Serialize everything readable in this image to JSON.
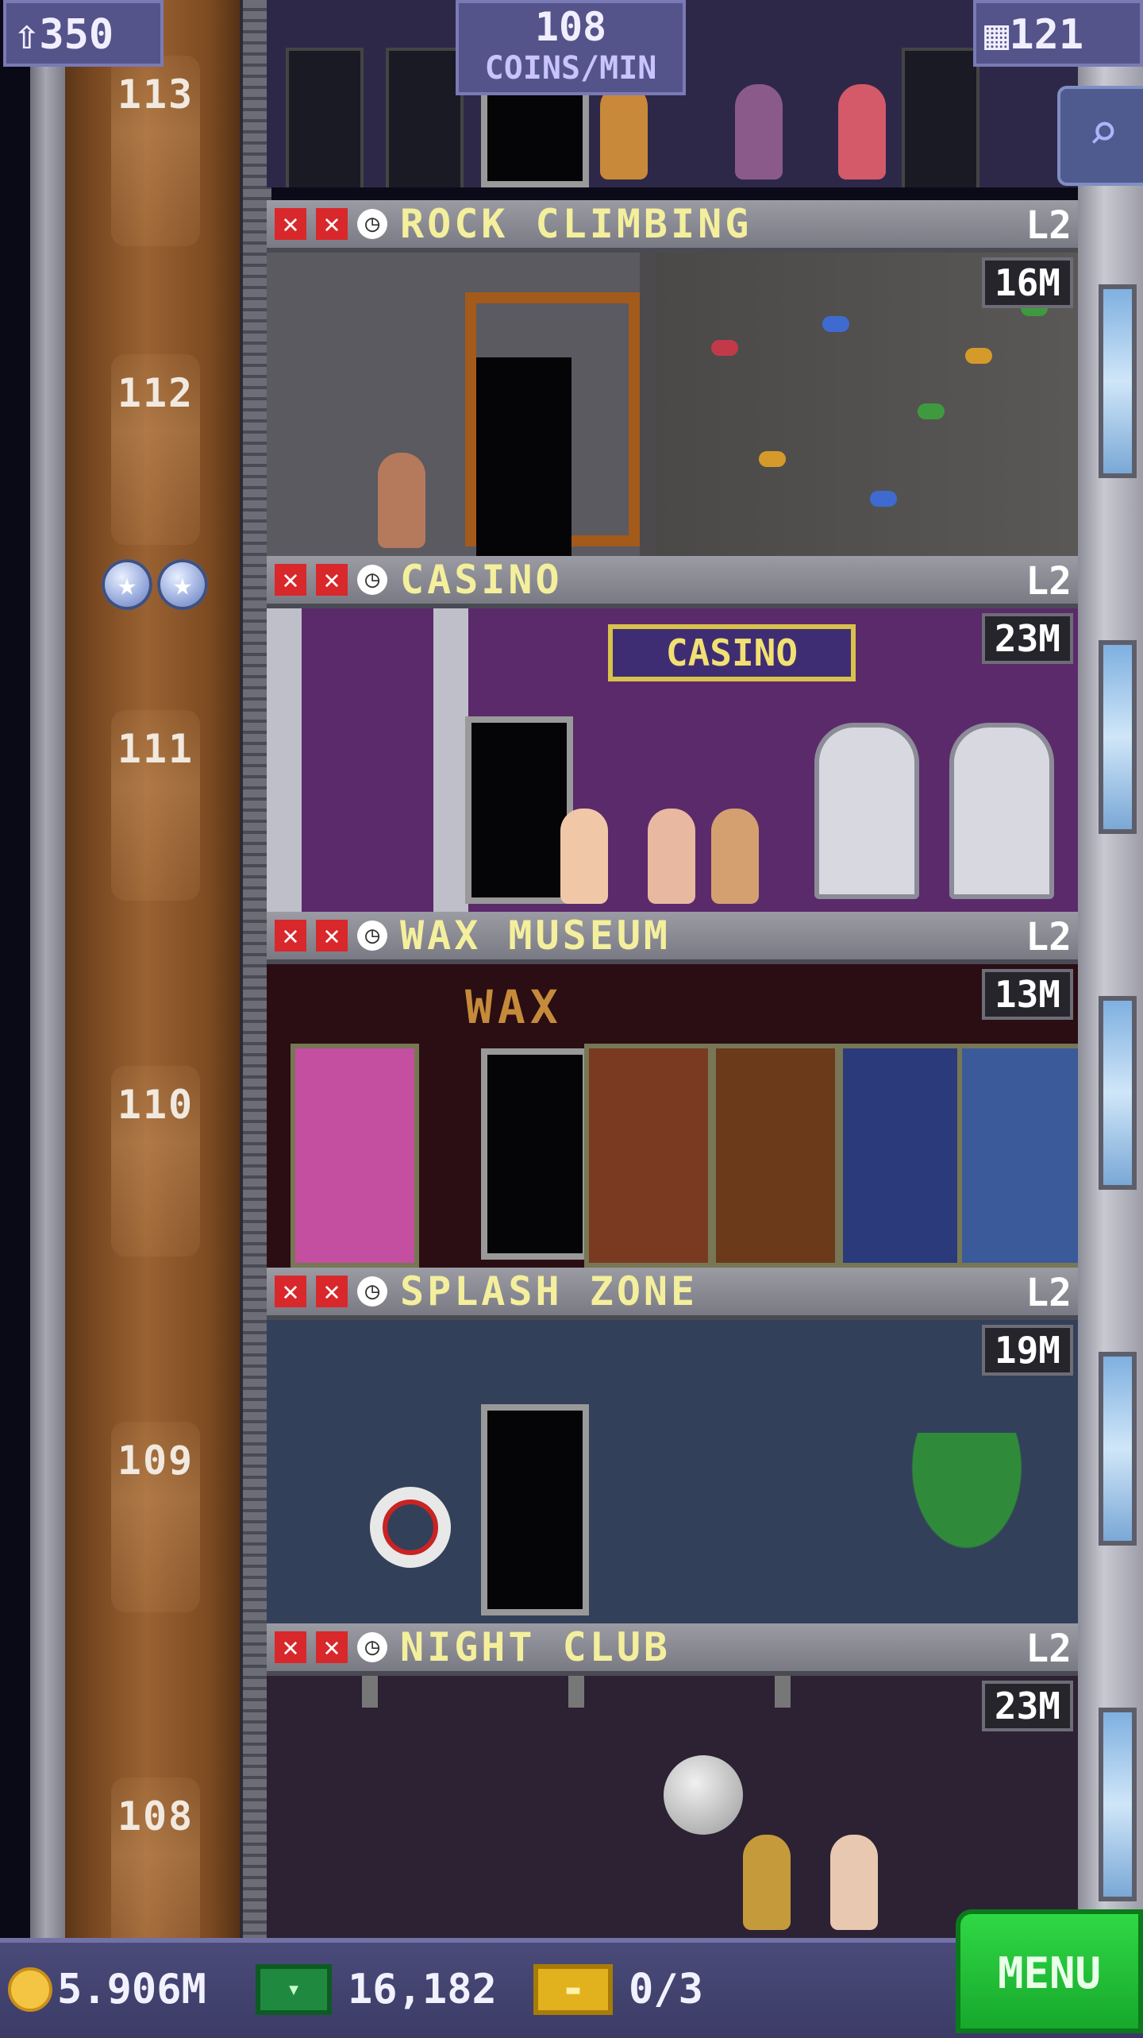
{
  "hud": {
    "population": "350",
    "coins_per_min_value": "108",
    "coins_per_min_label": "COINS/MIN",
    "stories": "121",
    "population_icon": "person-icon",
    "stories_icon": "building-icon",
    "search_icon": "magnifier-icon"
  },
  "floor_numbers": [
    "113",
    "112",
    "111",
    "110",
    "109",
    "108"
  ],
  "floors": [
    {
      "name": "ROCK CLIMBING",
      "level": "L2",
      "price": "16M"
    },
    {
      "name": "CASINO",
      "level": "L2",
      "price": "23M",
      "sign": "CASINO"
    },
    {
      "name": "WAX MUSEUM",
      "level": "L2",
      "price": "13M",
      "sign": "WAX"
    },
    {
      "name": "SPLASH ZONE",
      "level": "L2",
      "price": "19M"
    },
    {
      "name": "NIGHT CLUB",
      "level": "L2",
      "price": "23M"
    }
  ],
  "bottom": {
    "coins": "5.906M",
    "bux": "16,182",
    "tickets": "0/3",
    "menu_label": "MENU"
  },
  "colors": {
    "hud_bg": "#54548a",
    "floor_name": "#f4ef9c",
    "stock_out_x": "#d8282b",
    "menu_green": "#30d845",
    "shaft_brown": "#7b4a22"
  }
}
